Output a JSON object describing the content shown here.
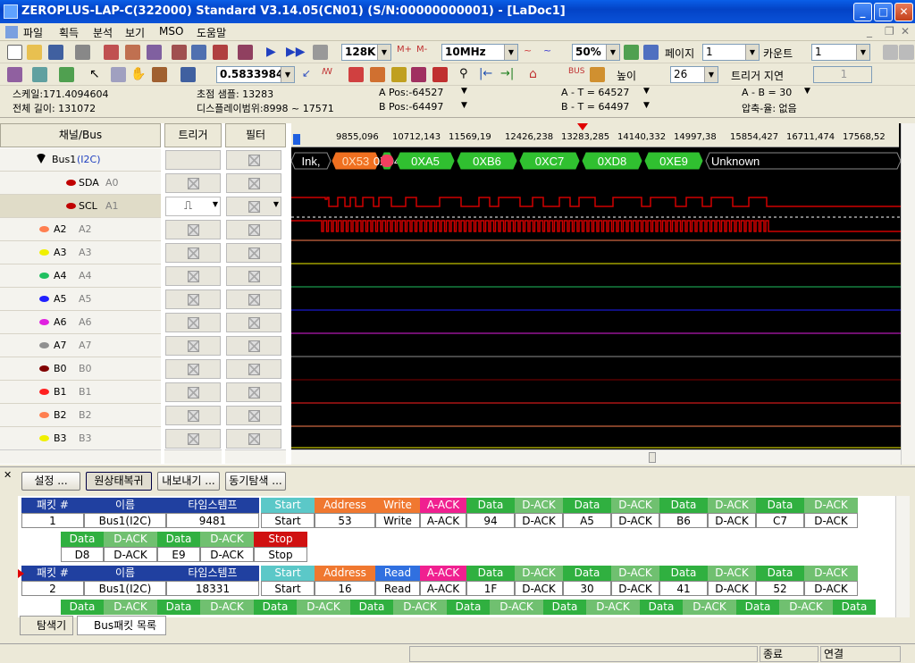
{
  "window": {
    "title": "ZEROPLUS-LAP-C(322000) Standard V3.14.05(CN01) (S/N:00000000001) - [LaDoc1]"
  },
  "menu": [
    "파일",
    "획득",
    "분석",
    "보기",
    "MSO",
    "도움말"
  ],
  "toolbar1": {
    "memory": "128K",
    "clock": "10MHz",
    "trigger_pos": "50%",
    "page_label": "페이지",
    "page_value": "1",
    "count_label": "카운트",
    "count_value": "1"
  },
  "toolbar2": {
    "zoom": "0.5833984",
    "height_label": "높이",
    "height_value": "26",
    "trigger_delay_label": "트리거 지연",
    "trigger_delay_value": "1"
  },
  "info": {
    "scale": "스케일:171.4094604",
    "total_len": "전체 길이: 131072",
    "focus_sample": "초점 샘플: 13283",
    "display_range": "디스플레이범위:8998 ~ 17571",
    "a_pos": "A Pos:-64527",
    "b_pos": "B Pos:-64497",
    "a_t": "A - T = 64527",
    "b_t": "B - T = 64497",
    "a_b": "A - B = 30",
    "compression": "압축-율: 없음"
  },
  "columns": {
    "channel": "채널/Bus",
    "trigger": "트리거",
    "filter": "필터"
  },
  "channels": [
    {
      "name": "Bus1",
      "alias": "(I2C)",
      "color": "#000"
    },
    {
      "name": "SDA",
      "alias": "A0",
      "color": "#c00000"
    },
    {
      "name": "SCL",
      "alias": "A1",
      "color": "#c00000"
    },
    {
      "name": "A2",
      "alias": "A2",
      "color": "#ff7f50"
    },
    {
      "name": "A3",
      "alias": "A3",
      "color": "#f0f000"
    },
    {
      "name": "A4",
      "alias": "A4",
      "color": "#20c060"
    },
    {
      "name": "A5",
      "alias": "A5",
      "color": "#2020ff"
    },
    {
      "name": "A6",
      "alias": "A6",
      "color": "#e020e0"
    },
    {
      "name": "A7",
      "alias": "A7",
      "color": "#909090"
    },
    {
      "name": "B0",
      "alias": "B0",
      "color": "#800000"
    },
    {
      "name": "B1",
      "alias": "B1",
      "color": "#ff2020"
    },
    {
      "name": "B2",
      "alias": "B2",
      "color": "#ff7f50"
    },
    {
      "name": "B3",
      "alias": "B3",
      "color": "#f0f000"
    }
  ],
  "ruler": [
    "9855,096",
    "10712,143",
    "11569,19",
    "12426,238",
    "13283,285",
    "14140,332",
    "14997,38",
    "15854,427",
    "16711,474",
    "17568,52"
  ],
  "bus_segments": [
    "Ink,",
    "0X53",
    "0X94",
    "0XA5",
    "0XB6",
    "0XC7",
    "0XD8",
    "0XE9",
    "Unknown"
  ],
  "bottom_buttons": [
    "설정 ...",
    "원상태복귀",
    "내보내기 ...",
    "동기탐색 ..."
  ],
  "packet_headers": [
    "패킷 #",
    "이름",
    "타임스템프"
  ],
  "packet1": {
    "id": "1",
    "name": "Bus1(I2C)",
    "ts": "9481",
    "fields": [
      [
        "Start",
        "Start"
      ],
      [
        "Address",
        "53"
      ],
      [
        "Write",
        "Write"
      ],
      [
        "A-ACK",
        "A-ACK"
      ],
      [
        "Data",
        "94"
      ],
      [
        "D-ACK",
        "D-ACK"
      ],
      [
        "Data",
        "A5"
      ],
      [
        "D-ACK",
        "D-ACK"
      ],
      [
        "Data",
        "B6"
      ],
      [
        "D-ACK",
        "D-ACK"
      ],
      [
        "Data",
        "C7"
      ],
      [
        "D-ACK",
        "D-ACK"
      ]
    ],
    "fields2": [
      [
        "Data",
        "D8"
      ],
      [
        "D-ACK",
        "D-ACK"
      ],
      [
        "Data",
        "E9"
      ],
      [
        "D-ACK",
        "D-ACK"
      ],
      [
        "Stop",
        "Stop"
      ]
    ]
  },
  "packet2": {
    "id": "2",
    "name": "Bus1(I2C)",
    "ts": "18331",
    "fields": [
      [
        "Start",
        "Start"
      ],
      [
        "Address",
        "16"
      ],
      [
        "Read",
        "Read"
      ],
      [
        "A-ACK",
        "A-ACK"
      ],
      [
        "Data",
        "1F"
      ],
      [
        "D-ACK",
        "D-ACK"
      ],
      [
        "Data",
        "30"
      ],
      [
        "D-ACK",
        "D-ACK"
      ],
      [
        "Data",
        "41"
      ],
      [
        "D-ACK",
        "D-ACK"
      ],
      [
        "Data",
        "52"
      ],
      [
        "D-ACK",
        "D-ACK"
      ]
    ],
    "fields2": [
      [
        "Data"
      ],
      [
        "D-ACK"
      ],
      [
        "Data"
      ],
      [
        "D-ACK"
      ],
      [
        "Data"
      ],
      [
        "D-ACK"
      ],
      [
        "Data"
      ],
      [
        "D-ACK"
      ],
      [
        "Data"
      ],
      [
        "D-ACK"
      ],
      [
        "Data"
      ],
      [
        "D-ACK"
      ],
      [
        "Data"
      ],
      [
        "D-ACK"
      ],
      [
        "Data"
      ],
      [
        "D-ACK"
      ],
      [
        "Data"
      ]
    ]
  },
  "bottom_tabs": [
    "탐색기",
    "Bus패킷 목록"
  ],
  "status": {
    "s1": "",
    "s2": "종료",
    "s3": "연결"
  },
  "field_colors": {
    "Start": "#5bc8c8",
    "Address": "#f07830",
    "Write": "#f07830",
    "Read": "#3070e0",
    "A-ACK": "#f02090",
    "Data": "#30b040",
    "D-ACK": "#70c070",
    "Stop": "#d01010"
  }
}
